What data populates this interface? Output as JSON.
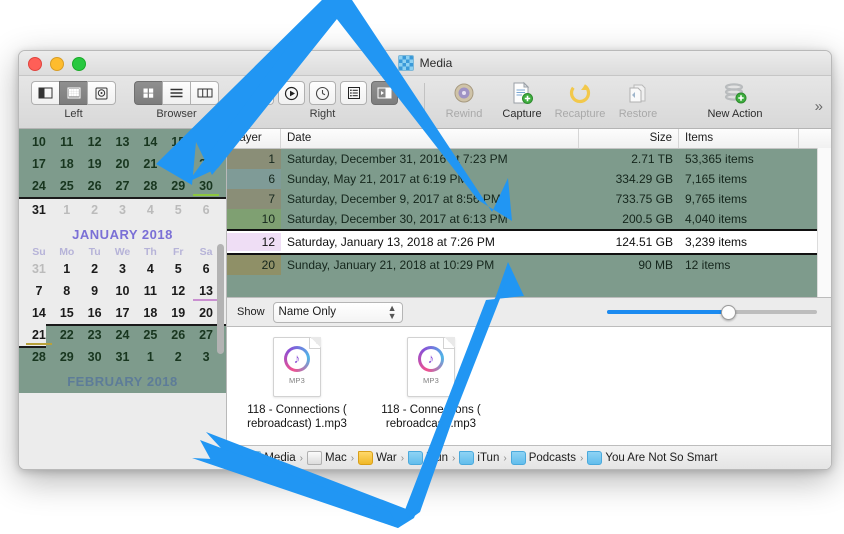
{
  "window": {
    "title": "Media",
    "title_icon": "app-icon",
    "traffic_lights": [
      "close",
      "minimize",
      "zoom"
    ]
  },
  "toolbar": {
    "left_group_label": "Left",
    "browser_group_label": "Browser",
    "right_group_label": "Right",
    "left_buttons": [
      {
        "name": "sidebar-toggle-icon",
        "active": false
      },
      {
        "name": "grid-view-icon",
        "active": true
      },
      {
        "name": "disk-icon",
        "active": false
      }
    ],
    "browser_buttons": [
      {
        "name": "icon-view-icon",
        "active": true
      },
      {
        "name": "list-view-icon",
        "active": false
      },
      {
        "name": "column-view-icon",
        "active": false
      }
    ],
    "right_buttons": [
      {
        "name": "info-icon",
        "active": false
      },
      {
        "name": "play-icon",
        "active": false
      },
      {
        "name": "clock-icon",
        "active": false
      },
      {
        "name": "list-icon",
        "active": false
      },
      {
        "name": "inspector-toggle-icon",
        "active": true
      }
    ],
    "actions": [
      {
        "label": "Rewind",
        "icon": "rewind-icon",
        "enabled": false
      },
      {
        "label": "Capture",
        "icon": "capture-icon",
        "enabled": true
      },
      {
        "label": "Recapture",
        "icon": "recapture-icon",
        "enabled": false
      },
      {
        "label": "Restore",
        "icon": "restore-icon",
        "enabled": false
      },
      {
        "label": "New Action",
        "icon": "new-action-icon",
        "enabled": true
      }
    ],
    "overflow_label": "»"
  },
  "calendar": {
    "partial_top_rows": [
      [
        "10",
        "11",
        "12",
        "13",
        "14",
        "15",
        "16"
      ],
      [
        "17",
        "18",
        "19",
        "20",
        "21",
        "22",
        "23"
      ],
      [
        "24",
        "25",
        "26",
        "27",
        "28",
        "29",
        "30"
      ]
    ],
    "december_last_row": [
      "31",
      "1",
      "2",
      "3",
      "4",
      "5",
      "6"
    ],
    "january": {
      "title": "JANUARY 2018",
      "dow": [
        "Su",
        "Mo",
        "Tu",
        "We",
        "Th",
        "Fr",
        "Sa"
      ],
      "weeks": [
        [
          "31",
          "1",
          "2",
          "3",
          "4",
          "5",
          "6"
        ],
        [
          "7",
          "8",
          "9",
          "10",
          "11",
          "12",
          "13"
        ],
        [
          "14",
          "15",
          "16",
          "17",
          "18",
          "19",
          "20"
        ],
        [
          "21",
          "22",
          "23",
          "24",
          "25",
          "26",
          "27"
        ],
        [
          "28",
          "29",
          "30",
          "31",
          "1",
          "2",
          "3"
        ]
      ]
    },
    "february": {
      "title": "FEBRUARY 2018"
    },
    "marker_days": [
      {
        "day": "30",
        "color": "#8cc63f"
      },
      {
        "day": "13",
        "color": "#c98fd0"
      },
      {
        "day": "21",
        "color": "#b8a13a"
      }
    ],
    "selection_color": "#7e9b8c"
  },
  "table": {
    "columns": [
      "Layer",
      "Date",
      "Size",
      "Items"
    ],
    "rows": [
      {
        "layer": "1",
        "date": "Saturday, December 31, 2016 at 7:23 PM",
        "size": "2.71 TB",
        "items": "53,365 items",
        "selected": false
      },
      {
        "layer": "6",
        "date": "Sunday, May 21, 2017 at 6:19 PM",
        "size": "334.29 GB",
        "items": "7,165 items",
        "selected": false
      },
      {
        "layer": "7",
        "date": "Saturday, December 9, 2017 at 8:56 PM",
        "size": "733.75 GB",
        "items": "9,765 items",
        "selected": false
      },
      {
        "layer": "10",
        "date": "Saturday, December 30, 2017 at 6:13 PM",
        "size": "200.5 GB",
        "items": "4,040 items",
        "selected": false
      },
      {
        "layer": "12",
        "date": "Saturday, January 13, 2018 at 7:26 PM",
        "size": "124.51 GB",
        "items": "3,239 items",
        "selected": true
      },
      {
        "layer": "20",
        "date": "Sunday, January 21, 2018 at 10:29 PM",
        "size": "90 MB",
        "items": "12 items",
        "selected": false
      }
    ]
  },
  "showbar": {
    "label": "Show",
    "popup_value": "Name Only",
    "popup_icon": "stepper-icon",
    "slider": {
      "value": 57,
      "min": 0,
      "max": 100,
      "accent": "#1c8bf0"
    }
  },
  "files": [
    {
      "name": "118 - Connections (\nrebroadcast) 1.mp3",
      "type": "MP3",
      "icon": "mp3-file-icon"
    },
    {
      "name": "118 - Connections (\nrebroadcast).mp3",
      "type": "MP3",
      "icon": "mp3-file-icon"
    }
  ],
  "pathbar": {
    "back_icon": "chevron-right-icon",
    "items": [
      {
        "label": "Media",
        "icon": "app"
      },
      {
        "label": "Mac",
        "icon": "disk"
      },
      {
        "label": "War",
        "icon": "yellow"
      },
      {
        "label": "iTun",
        "icon": "folder"
      },
      {
        "label": "iTun",
        "icon": "folder"
      },
      {
        "label": "Podcasts",
        "icon": "folder"
      },
      {
        "label": "You Are Not So Smart",
        "icon": "folder"
      }
    ],
    "separator": "›"
  },
  "annotations": {
    "arrow_color": "#2196f3",
    "arrows": [
      {
        "name": "arrow-to-calendar-day",
        "target": "calendar-day-15"
      },
      {
        "name": "arrow-to-table-row",
        "target": "table-row-layer-7"
      },
      {
        "name": "arrow-to-selected-row",
        "target": "selected-row-callout"
      },
      {
        "name": "arrow-to-calendar-bottom",
        "target": "february-band"
      }
    ]
  }
}
